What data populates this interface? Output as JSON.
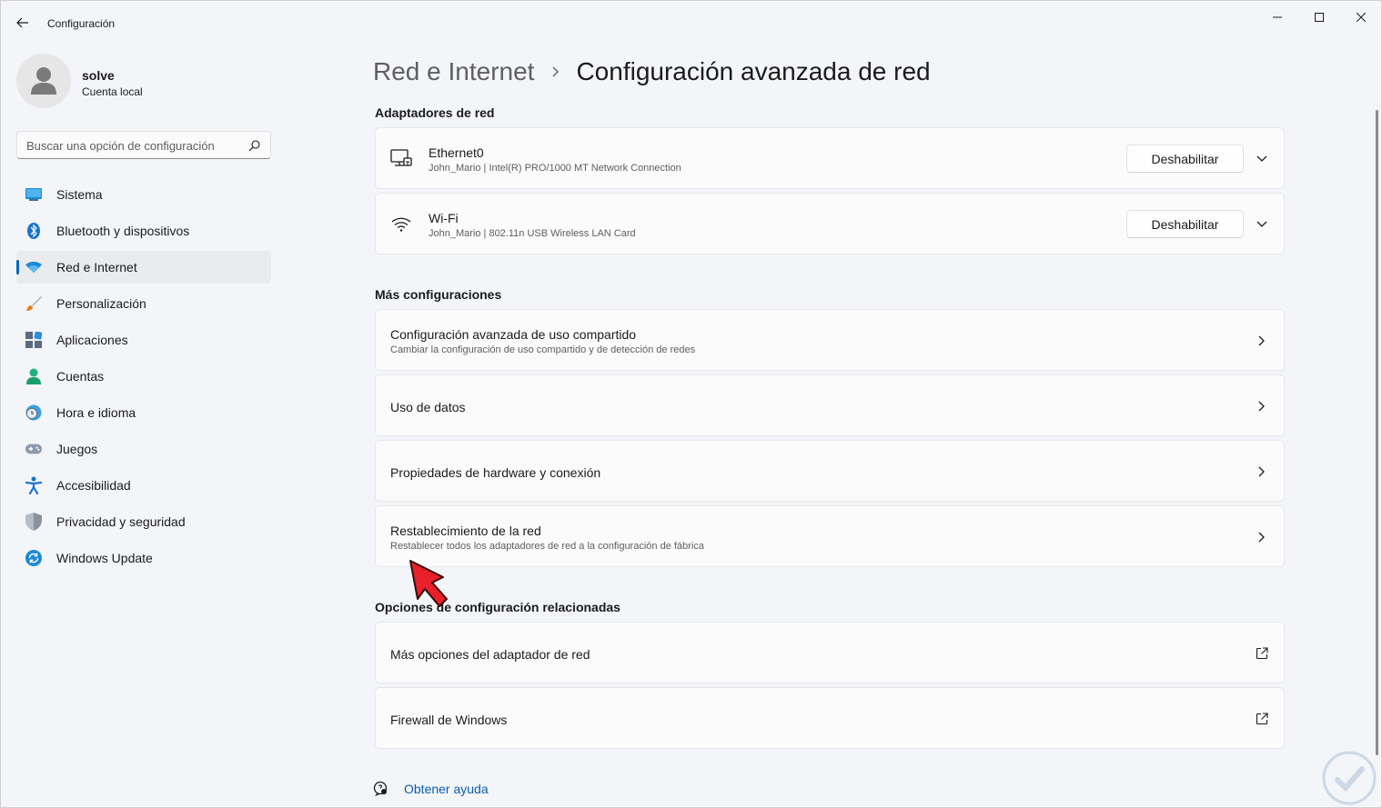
{
  "window": {
    "title": "Configuración",
    "controls": [
      "minimize",
      "maximize",
      "close"
    ]
  },
  "profile": {
    "name": "solve",
    "account_type": "Cuenta local"
  },
  "search": {
    "placeholder": "Buscar una opción de configuración"
  },
  "sidebar": {
    "items": [
      {
        "label": "Sistema",
        "icon": "system-icon",
        "active": false
      },
      {
        "label": "Bluetooth y dispositivos",
        "icon": "bluetooth-icon",
        "active": false
      },
      {
        "label": "Red e Internet",
        "icon": "wifi-icon",
        "active": true
      },
      {
        "label": "Personalización",
        "icon": "brush-icon",
        "active": false
      },
      {
        "label": "Aplicaciones",
        "icon": "apps-icon",
        "active": false
      },
      {
        "label": "Cuentas",
        "icon": "person-icon",
        "active": false
      },
      {
        "label": "Hora e idioma",
        "icon": "clock-globe-icon",
        "active": false
      },
      {
        "label": "Juegos",
        "icon": "gamepad-icon",
        "active": false
      },
      {
        "label": "Accesibilidad",
        "icon": "accessibility-icon",
        "active": false
      },
      {
        "label": "Privacidad y seguridad",
        "icon": "shield-icon",
        "active": false
      },
      {
        "label": "Windows Update",
        "icon": "update-icon",
        "active": false
      }
    ]
  },
  "breadcrumb": {
    "parent": "Red e Internet",
    "current": "Configuración avanzada de red"
  },
  "adapters": {
    "title": "Adaptadores de red",
    "items": [
      {
        "name": "Ethernet0",
        "description": "John_Mario | Intel(R) PRO/1000 MT Network Connection",
        "button": "Deshabilitar",
        "icon": "ethernet-icon"
      },
      {
        "name": "Wi-Fi",
        "description": "John_Mario | 802.11n USB Wireless LAN Card",
        "button": "Deshabilitar",
        "icon": "wifi-icon"
      }
    ]
  },
  "more": {
    "title": "Más configuraciones",
    "items": [
      {
        "title": "Configuración avanzada de uso compartido",
        "subtitle": "Cambiar la configuración de uso compartido y de detección de redes"
      },
      {
        "title": "Uso de datos",
        "subtitle": ""
      },
      {
        "title": "Propiedades de hardware y conexión",
        "subtitle": ""
      },
      {
        "title": "Restablecimiento de la red",
        "subtitle": "Restablecer todos los adaptadores de red a la configuración de fábrica"
      }
    ]
  },
  "related": {
    "title": "Opciones de configuración relacionadas",
    "items": [
      {
        "title": "Más opciones del adaptador de red"
      },
      {
        "title": "Firewall de Windows"
      }
    ]
  },
  "help": {
    "label": "Obtener ayuda"
  },
  "colors": {
    "accent": "#0067c0",
    "pointer": "#e8202a"
  }
}
